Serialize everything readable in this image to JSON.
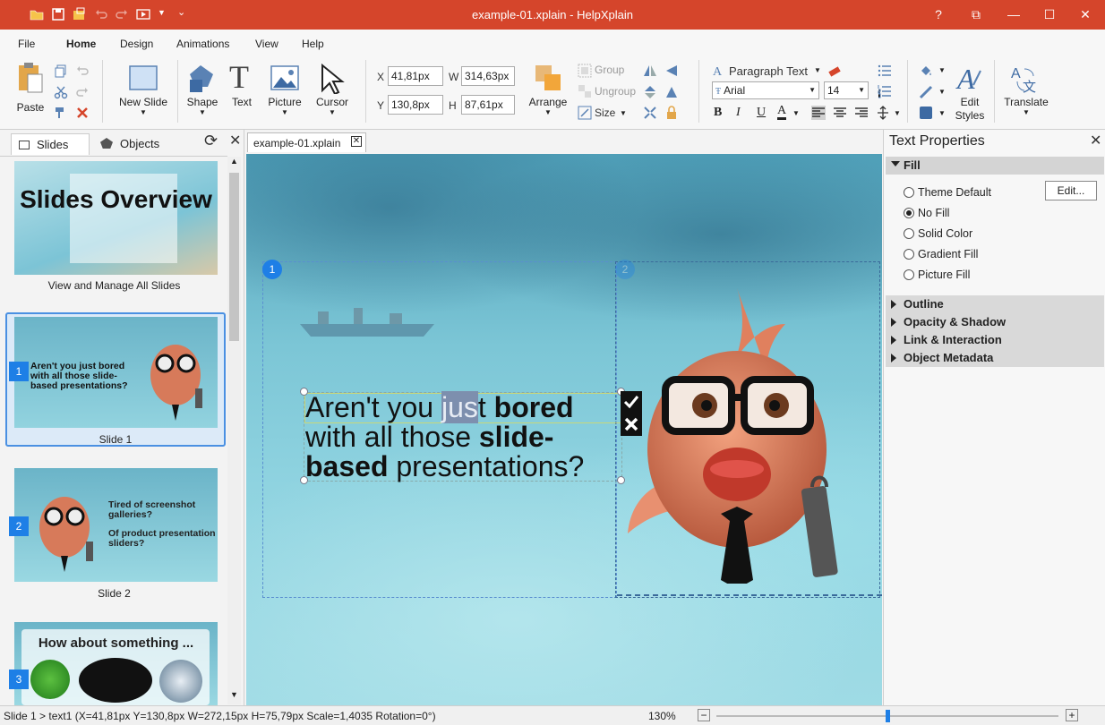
{
  "window": {
    "title": "example-01.xplain - HelpXplain",
    "help": "?",
    "buttons": [
      "?",
      "⧉",
      "—",
      "☐",
      "✕"
    ]
  },
  "colors": {
    "accent": "#d5452b",
    "selection": "#1e7fe6"
  },
  "menu": {
    "items": [
      "File",
      "Home",
      "Design",
      "Animations",
      "View",
      "Help"
    ],
    "active": "Home"
  },
  "ribbon": {
    "paste": "Paste",
    "new_slide": "New Slide",
    "shape": "Shape",
    "text": "Text",
    "picture": "Picture",
    "cursor": "Cursor",
    "x_label": "X",
    "x_value": "41,81px",
    "y_label": "Y",
    "y_value": "130,8px",
    "w_label": "W",
    "w_value": "314,63px",
    "h_label": "H",
    "h_value": "87,61px",
    "arrange": "Arrange",
    "group": "Group",
    "ungroup": "Ungroup",
    "size": "Size",
    "paragraph_style": "Paragraph Text",
    "font_name": "Arial",
    "font_size": "14",
    "bold": "B",
    "italic": "I",
    "underline": "U",
    "font_color": "A",
    "edit_styles": "Edit Styles",
    "translate": "Translate"
  },
  "left_panel": {
    "tab_slides": "Slides",
    "tab_objects": "Objects",
    "overview_title": "Slides Overview",
    "overview_caption": "View and Manage All Slides",
    "slides": [
      {
        "num": "1",
        "caption": "Slide 1",
        "text": "Aren't you just bored with all those slide-based presentations?"
      },
      {
        "num": "2",
        "caption": "Slide 2",
        "text1": "Tired of screenshot galleries?",
        "text2": "Of product presentation sliders?"
      },
      {
        "num": "3",
        "text": "How about something ..."
      }
    ]
  },
  "editor": {
    "doc_tab": "example-01.xplain",
    "marker1": "1",
    "marker2": "2",
    "line1_a": "Aren't you ",
    "line1_sel": "jus",
    "line1_b": "t ",
    "line1_bold": "bored",
    "line2_a": "with all those ",
    "line2_bold": "slide-",
    "line3_bold": "based",
    "line3_b": " presentations?"
  },
  "right_panel": {
    "title": "Text Properties",
    "fill_section": "Fill",
    "edit_button": "Edit...",
    "fill_options": [
      "Theme Default",
      "No Fill",
      "Solid Color",
      "Gradient Fill",
      "Picture Fill"
    ],
    "fill_selected": "No Fill",
    "sections": [
      "Outline",
      "Opacity & Shadow",
      "Link & Interaction",
      "Object Metadata"
    ]
  },
  "status": {
    "info": "Slide 1 > text1 (X=41,81px  Y=130,8px  W=272,15px  H=75,79px  Scale=1,4035  Rotation=0°)",
    "zoom": "130%",
    "zoom_level": 0.5,
    "minus": "−",
    "plus": "+"
  }
}
